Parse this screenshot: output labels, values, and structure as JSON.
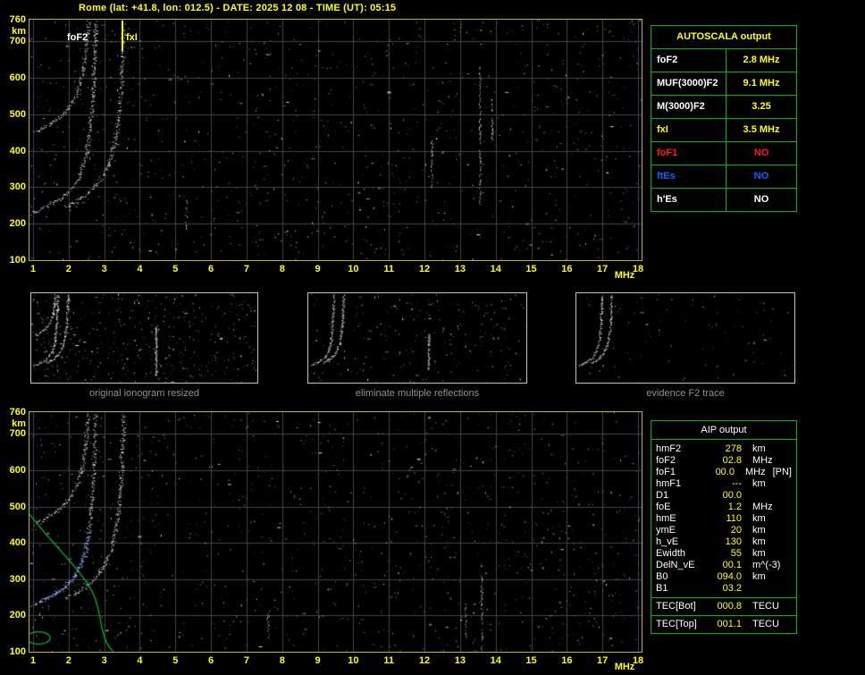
{
  "header": {
    "title": "Rome (lat: +41.8, lon: 012.5) - DATE: 2025 12 08 - TIME (UT): 05:15"
  },
  "colors": {
    "axis_yellow": "#ffff00",
    "panel_border": "#b9b91e",
    "thumb_border": "#c4c4c4",
    "grid": "#454545",
    "table_green": "#00b400",
    "caption_gray": "#909090",
    "white": "#ffffff",
    "red": "#ff1616",
    "blue": "#0064ff",
    "profile_green": "#00bb33",
    "restored_blue": "#3c5cff"
  },
  "top_panel": {
    "y_unit": "km",
    "x_unit": "MHz",
    "y_ticks": [
      "760",
      "700",
      "600",
      "500",
      "400",
      "300",
      "200",
      "100"
    ],
    "x_ticks": [
      "1",
      "2",
      "3",
      "4",
      "5",
      "6",
      "7",
      "8",
      "9",
      "10",
      "11",
      "12",
      "13",
      "14",
      "15",
      "16",
      "17",
      "18"
    ],
    "annotations": {
      "foF2_label": "foF2",
      "fxI_label": "fxI",
      "fxI_freq_mhz": 3.5
    }
  },
  "bottom_panel": {
    "y_unit": "km",
    "x_unit": "MHz",
    "y_ticks": [
      "760",
      "700",
      "600",
      "500",
      "400",
      "300",
      "200",
      "100"
    ],
    "x_ticks": [
      "1",
      "2",
      "3",
      "4",
      "5",
      "6",
      "7",
      "8",
      "9",
      "10",
      "11",
      "12",
      "13",
      "14",
      "15",
      "16",
      "17",
      "18"
    ]
  },
  "autoscala": {
    "title": "AUTOSCALA output",
    "rows": [
      {
        "label": "foF2",
        "value": "2.8 MHz",
        "label_color": "#ffffff",
        "value_color": "#ffff00"
      },
      {
        "label": "MUF(3000)F2",
        "value": "9.1 MHz",
        "label_color": "#ffffff",
        "value_color": "#ffff00"
      },
      {
        "label": "M(3000)F2",
        "value": "3.25",
        "label_color": "#ffffff",
        "value_color": "#ffff00"
      },
      {
        "label": "fxI",
        "value": "3.5 MHz",
        "label_color": "#ffff00",
        "value_color": "#ffff00"
      },
      {
        "label": "foF1",
        "value": "NO",
        "label_color": "#ff1616",
        "value_color": "#ff1616"
      },
      {
        "label": "ftEs",
        "value": "NO",
        "label_color": "#0064ff",
        "value_color": "#0064ff"
      },
      {
        "label": "h'Es",
        "value": "NO",
        "label_color": "#ffffff",
        "value_color": "#ffffff"
      }
    ]
  },
  "thumbnails": [
    {
      "caption": "original ionogram resized"
    },
    {
      "caption": "eliminate multiple reflections"
    },
    {
      "caption": "evidence F2 trace"
    }
  ],
  "aip": {
    "title": "AIP output",
    "rows": [
      {
        "label": "hmF2",
        "value": "278",
        "unit": "km"
      },
      {
        "label": "foF2",
        "value": "02.8",
        "unit": "MHz"
      },
      {
        "label": "foF1",
        "value": "00.0",
        "unit": "MHz",
        "extra": "[PN]"
      },
      {
        "label": "hmF1",
        "value": "---",
        "unit": "km"
      },
      {
        "label": "D1",
        "value": "00.0",
        "unit": ""
      },
      {
        "label": "foE",
        "value": "1.2",
        "unit": "MHz"
      },
      {
        "label": "hmE",
        "value": "110",
        "unit": "km"
      },
      {
        "label": "ymE",
        "value": "20",
        "unit": "km"
      },
      {
        "label": "h_vE",
        "value": "130",
        "unit": "km"
      },
      {
        "label": "Ewidth",
        "value": "55",
        "unit": "km"
      },
      {
        "label": "DelN_vE",
        "value": "00.1",
        "unit": "m^(-3)"
      },
      {
        "label": "B0",
        "value": "094.0",
        "unit": "km"
      },
      {
        "label": "B1",
        "value": "03.2",
        "unit": ""
      }
    ],
    "tec_rows": [
      {
        "label": "TEC[Bot]",
        "value": "000.8",
        "unit": "TECU"
      },
      {
        "label": "TEC[Top]",
        "value": "001.1",
        "unit": "TECU"
      }
    ]
  },
  "chart_data": {
    "type": "scatter",
    "title": "Ionogram virtual height vs frequency (Rome 2025-12-08 05:15 UT)",
    "x_axis": {
      "label": "MHz",
      "range": [
        1,
        18
      ]
    },
    "y_axis": {
      "label": "km",
      "range": [
        100,
        760
      ]
    },
    "autoscaled": {
      "foF2_mhz": 2.8,
      "fxI_mhz": 3.5
    },
    "traces": {
      "ordinary": [
        [
          0.95,
          228
        ],
        [
          1.2,
          240
        ],
        [
          1.45,
          252
        ],
        [
          1.7,
          266
        ],
        [
          1.95,
          284
        ],
        [
          2.15,
          308
        ],
        [
          2.33,
          340
        ],
        [
          2.47,
          382
        ],
        [
          2.57,
          440
        ],
        [
          2.64,
          510
        ],
        [
          2.69,
          590
        ],
        [
          2.73,
          680
        ],
        [
          2.75,
          758
        ]
      ],
      "extraordinary": [
        [
          1.9,
          248
        ],
        [
          2.2,
          262
        ],
        [
          2.5,
          282
        ],
        [
          2.78,
          308
        ],
        [
          3.0,
          340
        ],
        [
          3.18,
          382
        ],
        [
          3.32,
          440
        ],
        [
          3.42,
          515
        ],
        [
          3.48,
          600
        ],
        [
          3.52,
          690
        ],
        [
          3.54,
          758
        ]
      ],
      "second_hop": [
        [
          1.05,
          452
        ],
        [
          1.35,
          468
        ],
        [
          1.65,
          488
        ],
        [
          1.95,
          515
        ],
        [
          2.18,
          550
        ],
        [
          2.35,
          600
        ],
        [
          2.46,
          660
        ],
        [
          2.52,
          725
        ],
        [
          2.54,
          758
        ]
      ]
    },
    "profile_green": [
      [
        0.85,
        485
      ],
      [
        1.1,
        455
      ],
      [
        1.35,
        425
      ],
      [
        1.6,
        398
      ],
      [
        1.85,
        370
      ],
      [
        2.1,
        342
      ],
      [
        2.3,
        318
      ],
      [
        2.5,
        292
      ],
      [
        2.65,
        268
      ],
      [
        2.75,
        246
      ],
      [
        2.82,
        222
      ],
      [
        2.87,
        198
      ],
      [
        2.92,
        172
      ],
      [
        2.98,
        148
      ],
      [
        3.05,
        128
      ],
      [
        3.15,
        112
      ],
      [
        3.25,
        101
      ]
    ],
    "profile_ellipse": {
      "center": [
        1.15,
        138
      ],
      "rx": 0.33,
      "ry": 17
    },
    "restored_trace_km_range": [
      240,
      430
    ],
    "streaks_top": [
      {
        "f": 13.55,
        "km": [
          250,
          630
        ]
      },
      {
        "f": 13.9,
        "km": [
          430,
          545
        ]
      },
      {
        "f": 12.2,
        "km": [
          300,
          430
        ]
      },
      {
        "f": 5.3,
        "km": [
          185,
          265
        ]
      }
    ],
    "streaks_bottom": [
      {
        "f": 13.6,
        "km": [
          105,
          310
        ]
      },
      {
        "f": 13.15,
        "km": [
          140,
          235
        ]
      },
      {
        "f": 7.6,
        "km": [
          140,
          205
        ]
      }
    ],
    "noise_counts": {
      "top": 1050,
      "bottom": 1050,
      "thumbs": [
        420,
        210,
        90
      ]
    }
  }
}
